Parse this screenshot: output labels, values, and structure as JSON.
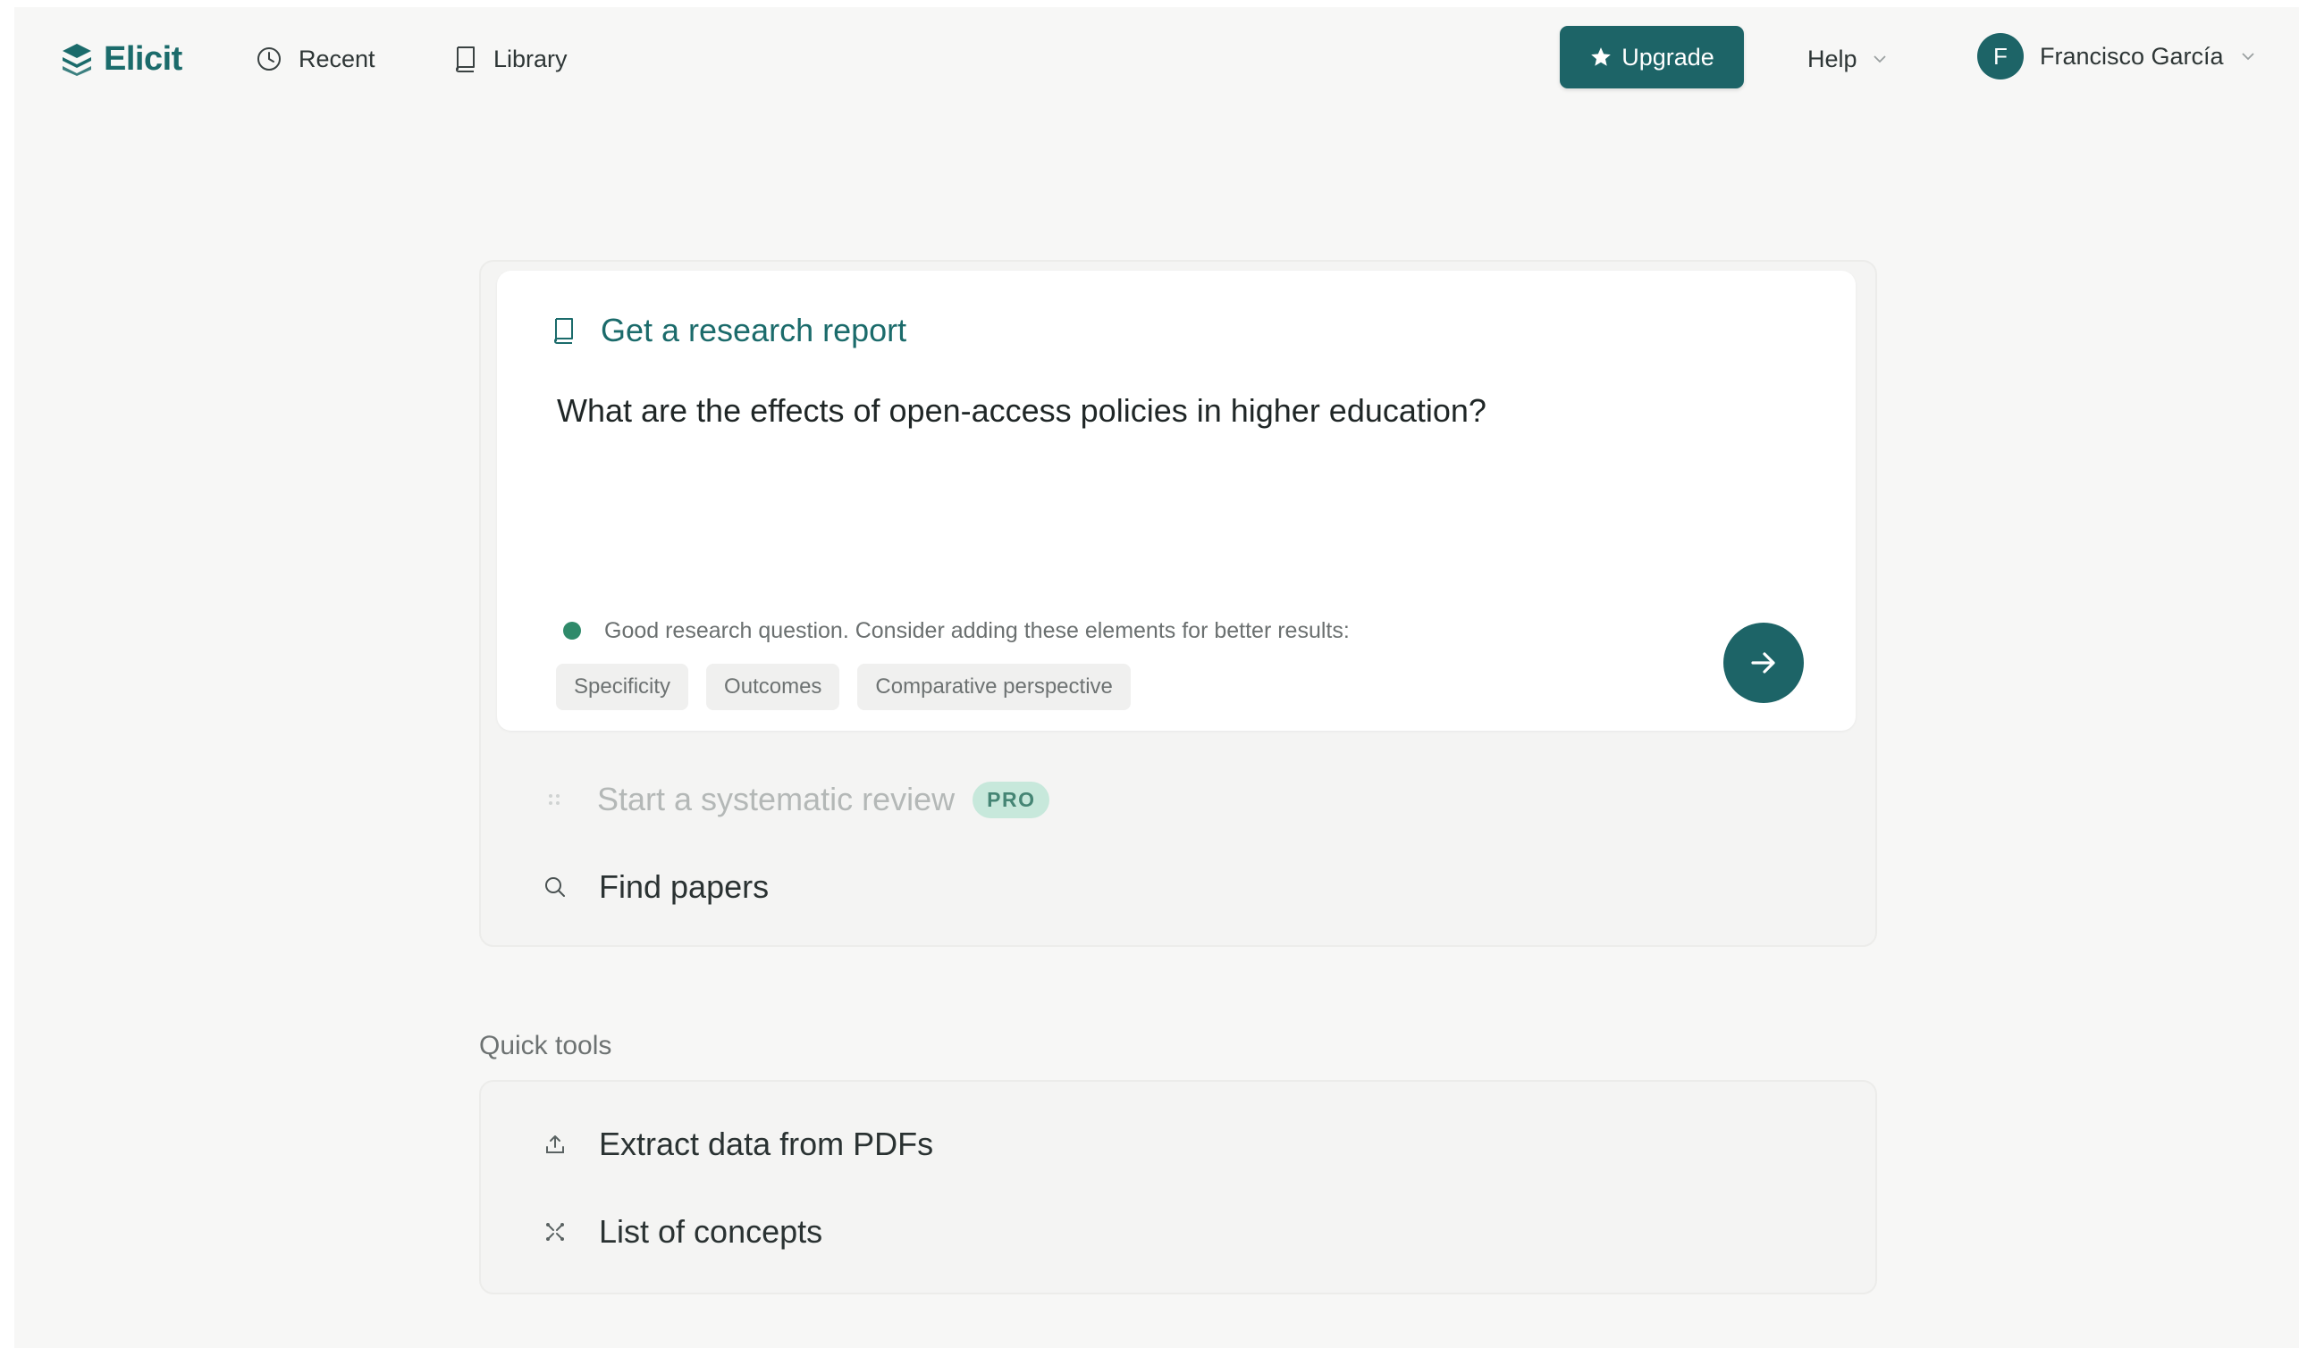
{
  "nav": {
    "logo": "Elicit",
    "recent": "Recent",
    "library": "Library",
    "upgrade": "Upgrade",
    "help": "Help",
    "user_initial": "F",
    "user_name": "Francisco García"
  },
  "report": {
    "title": "Get a research report",
    "question": "What are the effects of open-access policies in higher education?",
    "hint": "Good research question. Consider adding these elements for better results:",
    "chips": [
      "Specificity",
      "Outcomes",
      "Comparative perspective"
    ]
  },
  "options": {
    "systematic_review": "Start a systematic review",
    "pro_badge": "PRO",
    "find_papers": "Find papers"
  },
  "quick_tools": {
    "title": "Quick tools",
    "items": [
      "Extract data from PDFs",
      "List of concepts"
    ]
  },
  "colors": {
    "brand": "#1d6467",
    "accent_text": "#1b6b6b",
    "hint_dot": "#2f8a6a",
    "pro_badge_bg": "#bde6d6",
    "background": "#f7f7f6"
  },
  "icons": {
    "logo": "elicit-logo-icon",
    "recent": "clock-icon",
    "library": "book-icon",
    "upgrade": "star-icon",
    "dropdown": "chevron-down-icon",
    "report": "book-icon",
    "submit": "arrow-right-icon",
    "systematic_review": "dots-icon",
    "find_papers": "search-icon",
    "extract": "upload-icon",
    "concepts": "concepts-icon"
  }
}
